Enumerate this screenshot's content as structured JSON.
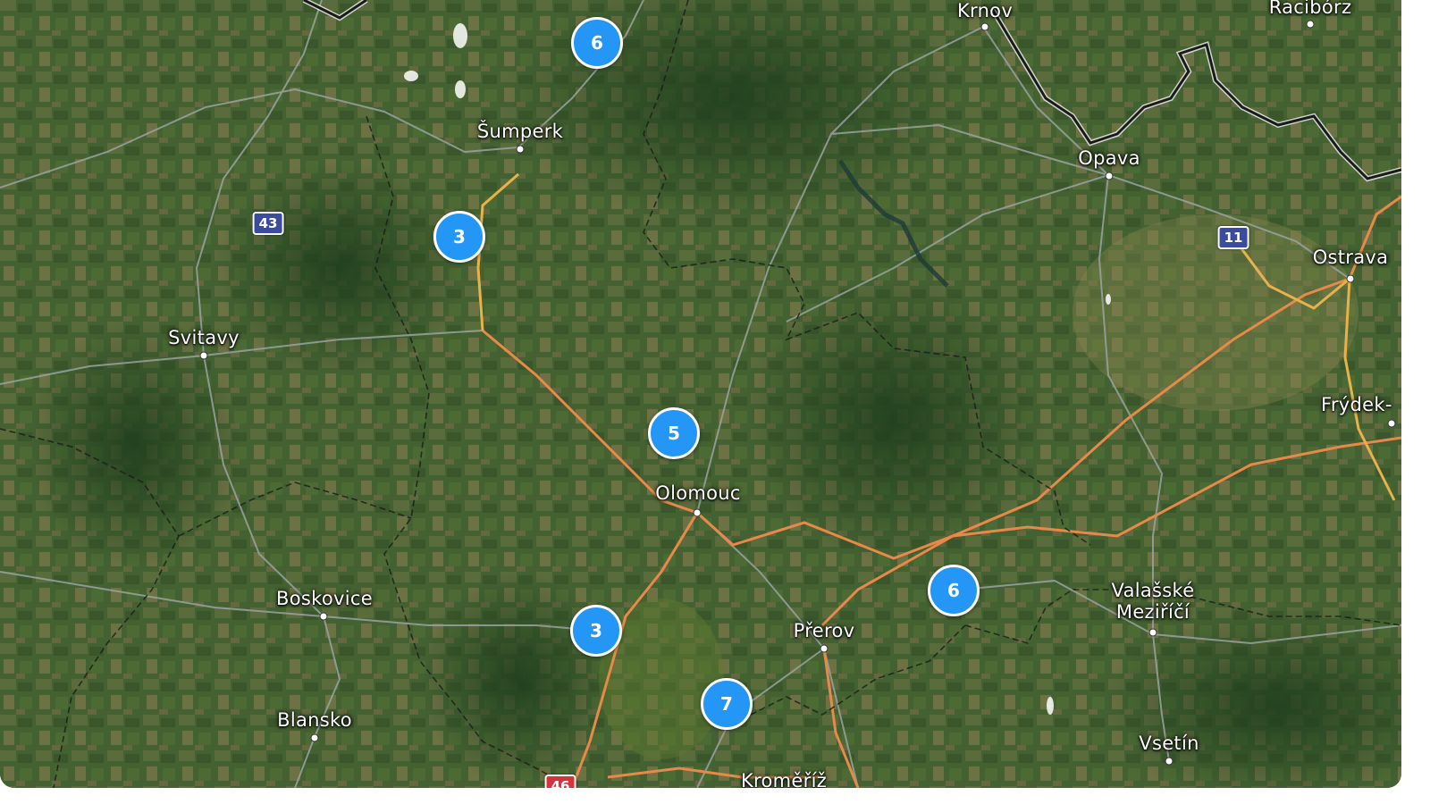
{
  "map": {
    "places": [
      {
        "id": "krnov",
        "name": "Krnov"
      },
      {
        "id": "raciborz",
        "name": "Racibórz"
      },
      {
        "id": "sumperk",
        "name": "Šumperk"
      },
      {
        "id": "opava",
        "name": "Opava"
      },
      {
        "id": "ostrava",
        "name": "Ostrava"
      },
      {
        "id": "svitavy",
        "name": "Svitavy"
      },
      {
        "id": "frydek",
        "name": "Frýdek-"
      },
      {
        "id": "olomouc",
        "name": "Olomouc"
      },
      {
        "id": "boskovice",
        "name": "Boskovice"
      },
      {
        "id": "valasske",
        "name": "Valašské\nMeziříčí"
      },
      {
        "id": "prerov",
        "name": "Přerov"
      },
      {
        "id": "blansko",
        "name": "Blansko"
      },
      {
        "id": "vsetin",
        "name": "Vsetín"
      },
      {
        "id": "kromeriz",
        "name": "Kroměříž"
      }
    ],
    "road_shields": [
      {
        "id": "r43",
        "label": "43",
        "color": "#3b4b9e"
      },
      {
        "id": "r11",
        "label": "11",
        "color": "#3b4b9e"
      },
      {
        "id": "r46",
        "label": "46",
        "color": "#d8323c"
      }
    ],
    "clusters": [
      {
        "id": "c1",
        "count": "6"
      },
      {
        "id": "c2",
        "count": "3"
      },
      {
        "id": "c3",
        "count": "5"
      },
      {
        "id": "c4",
        "count": "6"
      },
      {
        "id": "c5",
        "count": "3"
      },
      {
        "id": "c6",
        "count": "7"
      }
    ]
  }
}
